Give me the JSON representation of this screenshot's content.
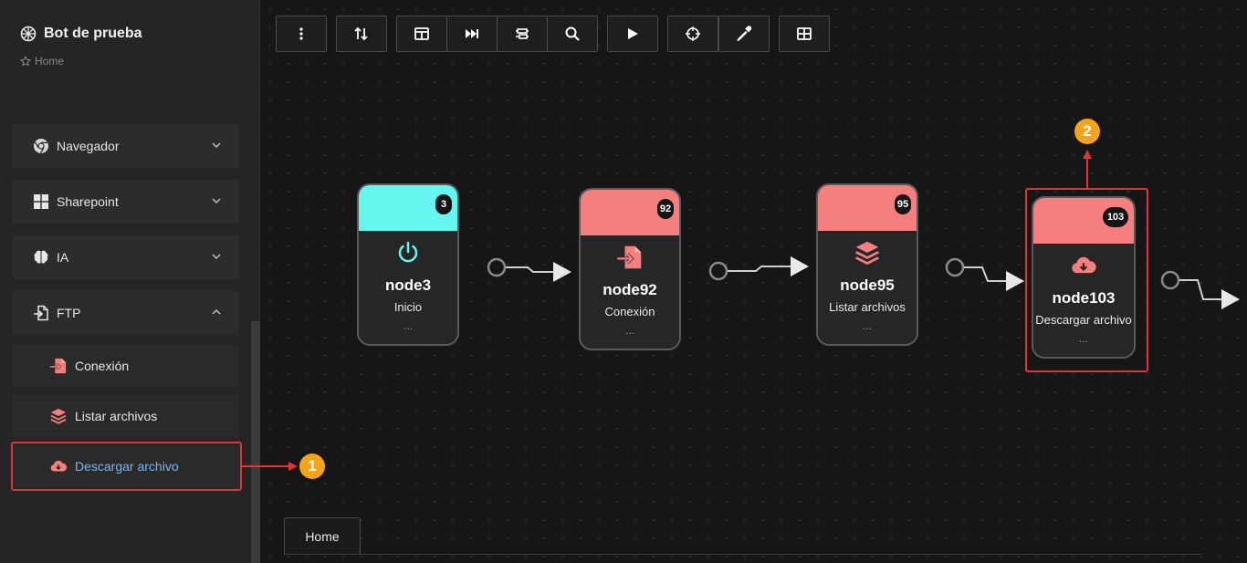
{
  "app": {
    "title": "Bot de prueba",
    "breadcrumb": "Home"
  },
  "sidebar": {
    "groups": [
      {
        "label": "Navegador",
        "icon": "chrome-icon",
        "expanded": false
      },
      {
        "label": "Sharepoint",
        "icon": "windows-icon",
        "expanded": false
      },
      {
        "label": "IA",
        "icon": "brain-icon",
        "expanded": false
      },
      {
        "label": "FTP",
        "icon": "file-import-icon",
        "expanded": true
      }
    ],
    "ftp_items": [
      {
        "label": "Conexión",
        "icon": "file-import-icon"
      },
      {
        "label": "Listar archivos",
        "icon": "layers-icon"
      },
      {
        "label": "Descargar archivo",
        "icon": "cloud-download-icon",
        "active": true
      }
    ]
  },
  "toolbar": [
    "more-vertical-icon",
    "sort-icon",
    "panel-icon",
    "skip-forward-icon",
    "align-icon",
    "search-icon",
    "play-icon",
    "crosshair-icon",
    "eyedropper-icon",
    "grid-icon"
  ],
  "nodes": [
    {
      "id": "node3",
      "label": "Inicio",
      "count": "3",
      "dots": "...",
      "color": "#66f5ef",
      "icon": "power-icon"
    },
    {
      "id": "node92",
      "label": "Conexión",
      "count": "92",
      "dots": "...",
      "color": "#f57f7f",
      "icon": "file-import-icon"
    },
    {
      "id": "node95",
      "label": "Listar archivos",
      "count": "95",
      "dots": "...",
      "color": "#f57f7f",
      "icon": "layers-icon"
    },
    {
      "id": "node103",
      "label": "Descargar archivo",
      "count": "103",
      "dots": "...",
      "color": "#f57f7f",
      "icon": "cloud-download-icon"
    }
  ],
  "annotations": {
    "marker1": "1",
    "marker2": "2"
  },
  "tabs": [
    {
      "label": "Home"
    }
  ],
  "colors": {
    "accent_red": "#f57f7f",
    "accent_cyan": "#66f5ef",
    "highlight": "#e03535",
    "marker": "#f5a31a",
    "active_link": "#6fb7ff"
  }
}
